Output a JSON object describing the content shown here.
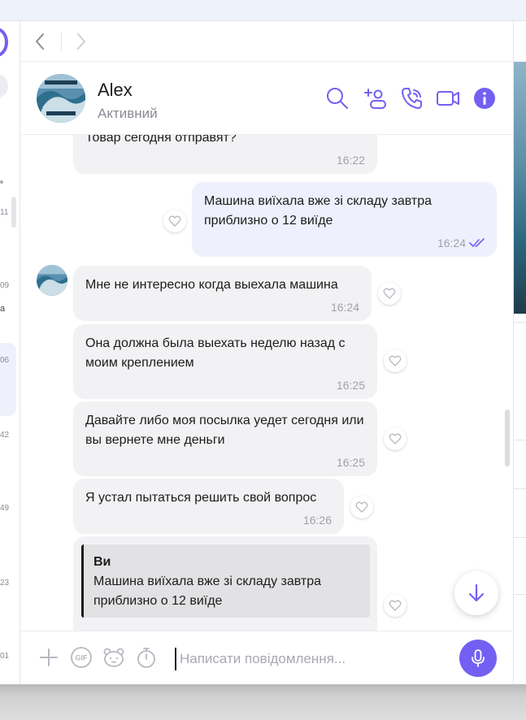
{
  "colors": {
    "accent": "#7360f2",
    "incoming_bubble": "#f2f2f4",
    "outgoing_bubble": "#eef1fd"
  },
  "left_list": {
    "times": [
      "11",
      "09",
      "06",
      "42",
      "49",
      "23",
      "01"
    ],
    "fragment": "а"
  },
  "nav": {
    "back_icon": "chevron-left-icon",
    "forward_icon": "chevron-right-icon"
  },
  "header": {
    "name": "Alex",
    "status": "Активний",
    "icons": [
      "search-icon",
      "add-participant-icon",
      "call-icon",
      "video-call-icon",
      "info-icon"
    ]
  },
  "messages": [
    {
      "direction": "in",
      "text": "Товар сегодня отправят?",
      "time": "16:22"
    },
    {
      "direction": "out",
      "text": "Машина виїхала вже зі складу завтра приблизно о 12 виїде",
      "time": "16:24",
      "status_icon": "double-check-icon"
    },
    {
      "direction": "in",
      "text": "Мне не интересно когда выехала машина",
      "time": "16:24"
    },
    {
      "direction": "in",
      "text": "Она должна была выехать неделю назад с моим креплением",
      "time": "16:25"
    },
    {
      "direction": "in",
      "text": "Давайте либо моя посылка уедет сегодня или вы вернете мне деньги",
      "time": "16:25"
    },
    {
      "direction": "in",
      "text": "Я устал пытаться решить свой вопрос",
      "time": "16:26"
    },
    {
      "direction": "in",
      "quote": {
        "author": "Ви",
        "text": "Машина виїхала вже зі складу завтра приблизно о 12 виїде"
      }
    }
  ],
  "composer": {
    "placeholder": "Написати повідомлення...",
    "icons": [
      "plus-icon",
      "gif-icon",
      "sticker-icon",
      "timer-icon",
      "microphone-icon"
    ]
  },
  "scroll_down_icon": "arrow-down-icon"
}
